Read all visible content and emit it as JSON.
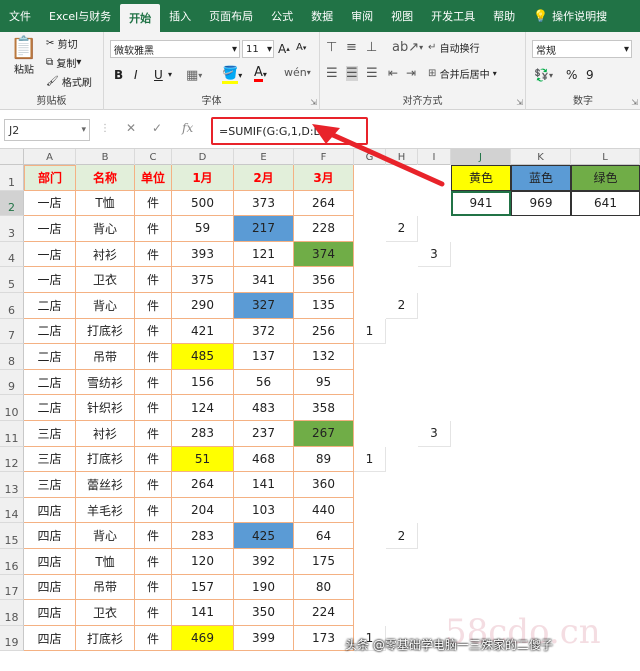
{
  "menu": {
    "tabs": [
      "文件",
      "Excel与财务",
      "开始",
      "插入",
      "页面布局",
      "公式",
      "数据",
      "审阅",
      "视图",
      "开发工具",
      "帮助"
    ],
    "active": "开始",
    "tell_me": "操作说明搜"
  },
  "ribbon": {
    "clipboard": {
      "paste": "粘贴",
      "cut": "剪切",
      "copy": "复制",
      "format_painter": "格式刷",
      "group": "剪贴板"
    },
    "font": {
      "name": "微软雅黑",
      "size": "11",
      "bold": "B",
      "italic": "I",
      "underline": "U",
      "grow": "A",
      "shrink": "A",
      "wen": "wén",
      "group": "字体"
    },
    "alignment": {
      "wrap": "自动换行",
      "merge": "合并后居中",
      "group": "对齐方式"
    },
    "number": {
      "format": "常规",
      "percent": "%",
      "comma": "9",
      "group": "数字"
    }
  },
  "formula_bar": {
    "name_box": "J2",
    "fx": "fx",
    "formula": "=SUMIF(G:G,1,D:D)"
  },
  "columns": [
    "A",
    "B",
    "C",
    "D",
    "E",
    "F",
    "G",
    "H",
    "I",
    "J",
    "K",
    "L"
  ],
  "rows": [
    "1",
    "2",
    "3",
    "4",
    "5",
    "6",
    "7",
    "8",
    "9",
    "10",
    "11",
    "12",
    "13",
    "14",
    "15",
    "16",
    "17",
    "18",
    "19"
  ],
  "table": {
    "headers": [
      "部门",
      "名称",
      "单位",
      "1月",
      "2月",
      "3月"
    ],
    "data": [
      [
        "一店",
        "T恤",
        "件",
        "500",
        "373",
        "264",
        "",
        "",
        ""
      ],
      [
        "一店",
        "背心",
        "件",
        "59",
        "217",
        "228",
        "",
        "2",
        ""
      ],
      [
        "一店",
        "衬衫",
        "件",
        "393",
        "121",
        "374",
        "",
        "",
        "3"
      ],
      [
        "一店",
        "卫衣",
        "件",
        "375",
        "341",
        "356",
        "",
        "",
        ""
      ],
      [
        "二店",
        "背心",
        "件",
        "290",
        "327",
        "135",
        "",
        "2",
        ""
      ],
      [
        "二店",
        "打底衫",
        "件",
        "421",
        "372",
        "256",
        "1",
        "",
        ""
      ],
      [
        "二店",
        "吊带",
        "件",
        "485",
        "137",
        "132",
        "",
        "",
        ""
      ],
      [
        "二店",
        "雪纺衫",
        "件",
        "156",
        "56",
        "95",
        "",
        "",
        ""
      ],
      [
        "二店",
        "针织衫",
        "件",
        "124",
        "483",
        "358",
        "",
        "",
        ""
      ],
      [
        "三店",
        "衬衫",
        "件",
        "283",
        "237",
        "267",
        "",
        "",
        "3"
      ],
      [
        "三店",
        "打底衫",
        "件",
        "51",
        "468",
        "89",
        "1",
        "",
        ""
      ],
      [
        "三店",
        "蕾丝衫",
        "件",
        "264",
        "141",
        "360",
        "",
        "",
        ""
      ],
      [
        "四店",
        "羊毛衫",
        "件",
        "204",
        "103",
        "440",
        "",
        "",
        ""
      ],
      [
        "四店",
        "背心",
        "件",
        "283",
        "425",
        "64",
        "",
        "2",
        ""
      ],
      [
        "四店",
        "T恤",
        "件",
        "120",
        "392",
        "175",
        "",
        "",
        ""
      ],
      [
        "四店",
        "吊带",
        "件",
        "157",
        "190",
        "80",
        "",
        "",
        ""
      ],
      [
        "四店",
        "卫衣",
        "件",
        "141",
        "350",
        "224",
        "",
        "",
        ""
      ],
      [
        "四店",
        "打底衫",
        "件",
        "469",
        "399",
        "173",
        "1",
        "",
        ""
      ]
    ]
  },
  "summary": {
    "headers": [
      "黄色",
      "蓝色",
      "绿色"
    ],
    "values": [
      "941",
      "969",
      "641"
    ]
  },
  "highlights": {
    "yellow": "#ffff00",
    "blue": "#5b9bd5",
    "green": "#70ad47",
    "header_fill": "#e2efda",
    "header_text": "#ff0000",
    "border_orange": "#f4b183"
  },
  "watermark": "头条 @零基础学电脑一三殊家的二傻子",
  "watermark_bg": "58cdo.cn"
}
